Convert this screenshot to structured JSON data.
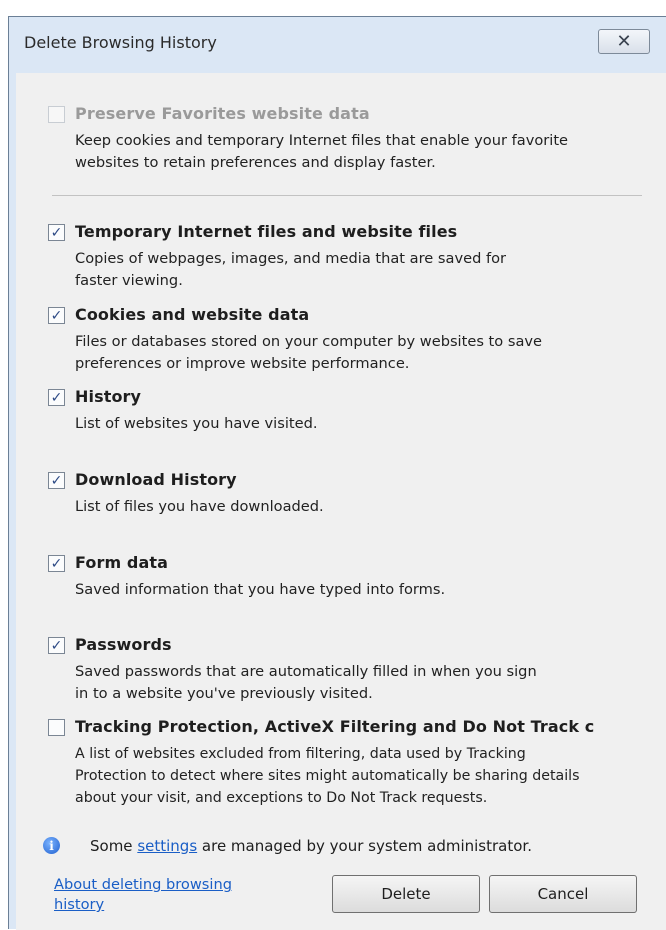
{
  "dialog": {
    "title": "Delete Browsing History",
    "close_label": "✕"
  },
  "options": [
    {
      "key": "preserve",
      "label": "Preserve Favorites website data",
      "checked": false,
      "disabled": true,
      "desc": "Keep cookies and temporary Internet files that enable your favorite\nwebsites to retain preferences and display faster."
    },
    {
      "key": "temp",
      "label": "Temporary Internet files and website files",
      "checked": true,
      "desc": "Copies of webpages, images, and media that are saved for\nfaster viewing."
    },
    {
      "key": "cookies",
      "label": "Cookies and website data",
      "checked": true,
      "desc": "Files or databases stored on your computer by websites to save\npreferences or improve website performance."
    },
    {
      "key": "history",
      "label": "History",
      "checked": true,
      "desc": "List of websites you have visited."
    },
    {
      "key": "download",
      "label": "Download History",
      "checked": true,
      "desc": "List of files you have downloaded."
    },
    {
      "key": "form",
      "label": "Form data",
      "checked": true,
      "desc": "Saved information that you have typed into forms."
    },
    {
      "key": "passwords",
      "label": "Passwords",
      "checked": true,
      "desc": "Saved passwords that are automatically filled in when you sign\nin to a website you've previously visited."
    },
    {
      "key": "tracking",
      "label": "Tracking Protection, ActiveX Filtering and Do Not Track c",
      "checked": false,
      "desc": "A list of websites excluded from filtering, data used by Tracking\nProtection to detect where sites might automatically be sharing details\nabout your visit, and exceptions to Do Not Track requests."
    }
  ],
  "info": {
    "prefix": "Some ",
    "link": "settings",
    "suffix": " are managed by your system administrator."
  },
  "footer": {
    "about_link": "About deleting browsing history",
    "delete_label": "Delete",
    "cancel_label": "Cancel"
  }
}
